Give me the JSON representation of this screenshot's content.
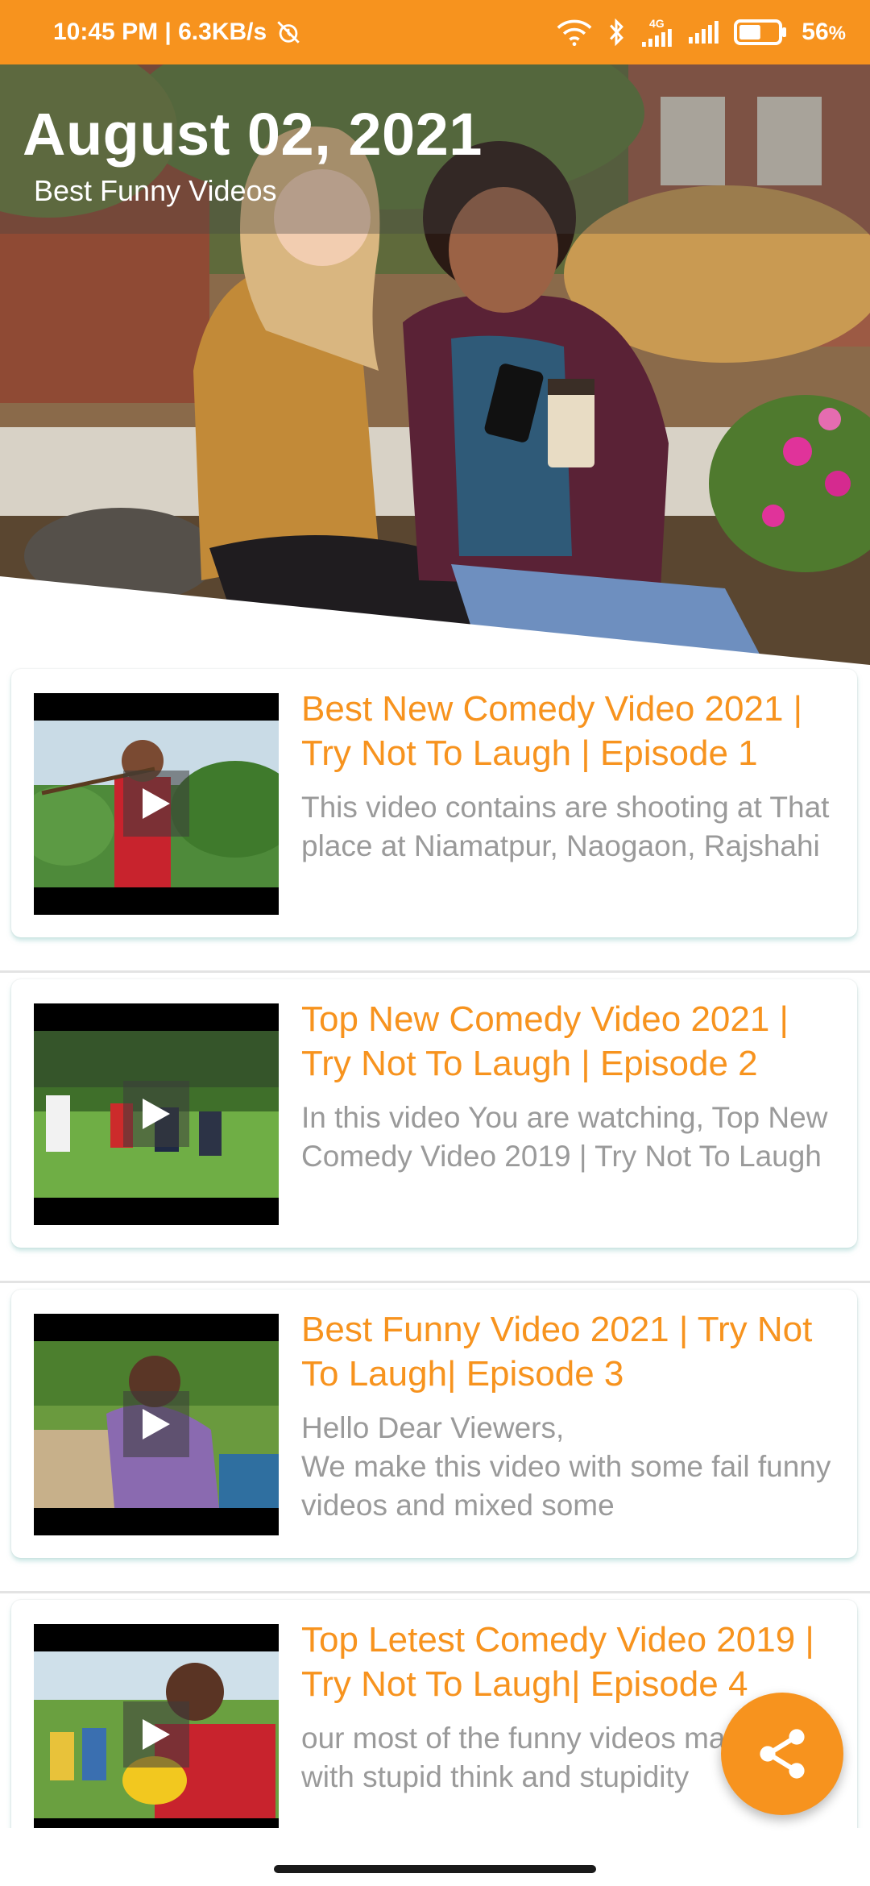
{
  "status_bar": {
    "time_speed": "10:45 PM | 6.3KB/s",
    "network_label": "4G",
    "battery_percent": "56",
    "battery_unit": "%",
    "battery_level": 0.56
  },
  "hero": {
    "date": "August 02, 2021",
    "subtitle": "Best Funny Videos"
  },
  "videos": [
    {
      "title": "Best New Comedy Video 2021 | Try Not To Laugh | Episode 1",
      "description": "This video contains are shooting at That place at Niamatpur, Naogaon, Rajshahi"
    },
    {
      "title": "Top New Comedy Video 2021 | Try Not To Laugh | Episode 2",
      "description": "In this video You are watching, Top New Comedy Video 2019 | Try Not To Laugh"
    },
    {
      "title": "Best Funny Video 2021 | Try Not To Laugh| Episode 3",
      "description": "Hello Dear Viewers,\nWe make this video with some fail funny videos and mixed some"
    },
    {
      "title": "Top Letest Comedy Video 2019 | Try Not To Laugh| Episode 4",
      "description": "our most of the funny videos making with stupid think and stupidity"
    }
  ],
  "icons": {
    "fab": "share-icon",
    "play": "play-icon"
  },
  "colors": {
    "accent": "#F7931E",
    "description_text": "#9a9a9a"
  }
}
